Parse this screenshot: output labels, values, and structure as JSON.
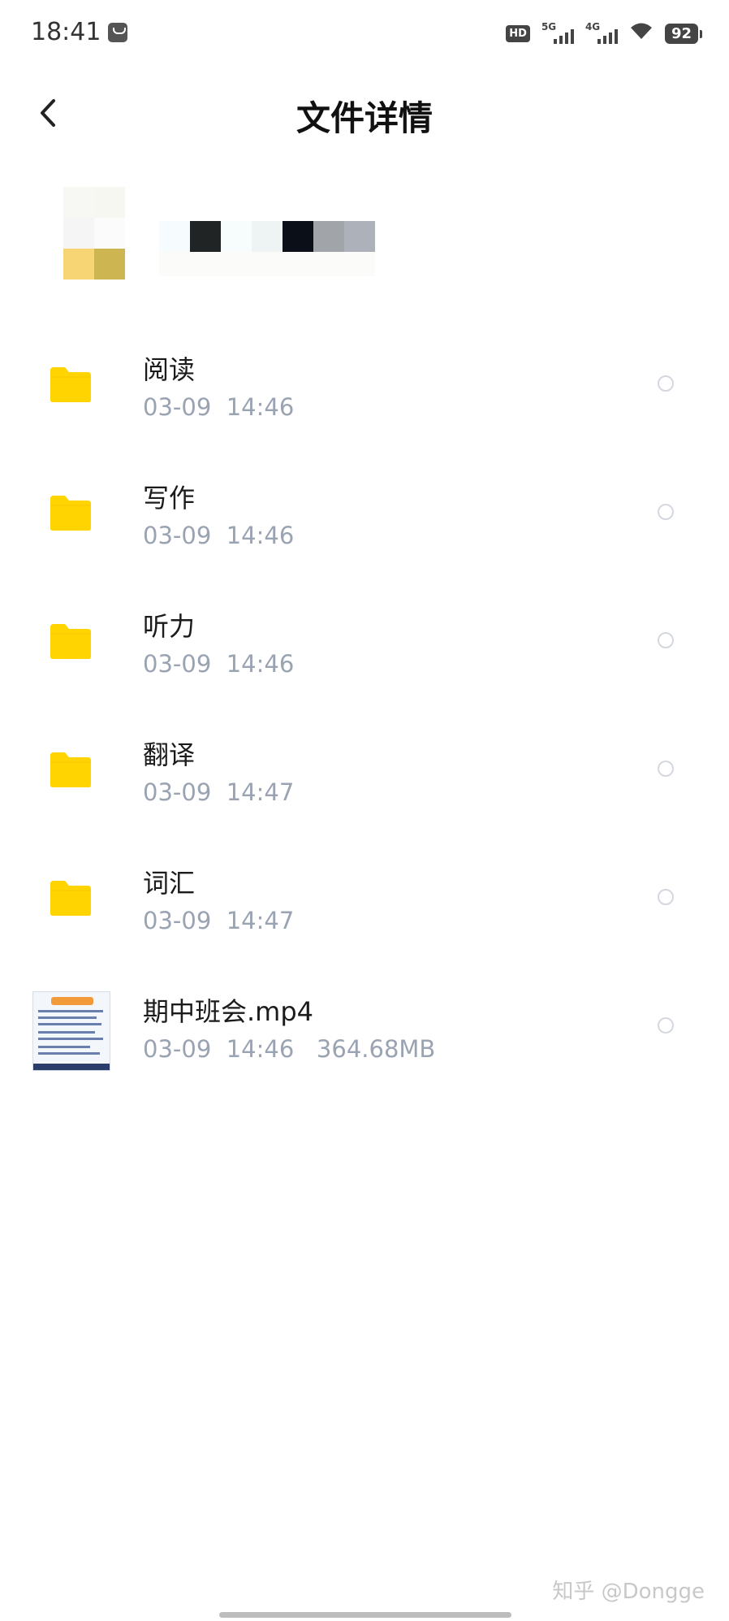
{
  "status_bar": {
    "time": "18:41",
    "hd_label": "HD",
    "network_1": "5G",
    "network_2": "4G",
    "battery": "92"
  },
  "header": {
    "title": "文件详情"
  },
  "files": [
    {
      "name": "阅读",
      "meta": "03-09  14:46",
      "icon": "folder-icon"
    },
    {
      "name": "写作",
      "meta": "03-09  14:46",
      "icon": "folder-icon"
    },
    {
      "name": "听力",
      "meta": "03-09  14:46",
      "icon": "folder-icon"
    },
    {
      "name": "翻译",
      "meta": "03-09  14:47",
      "icon": "folder-icon"
    },
    {
      "name": "词汇",
      "meta": "03-09  14:47",
      "icon": "folder-icon"
    },
    {
      "name": "期中班会.mp4",
      "meta": "03-09  14:46   364.68MB",
      "icon": "video-thumbnail"
    }
  ],
  "colors": {
    "folder": "#FFD400",
    "meta_text": "#9AA3B2"
  },
  "watermark": "知乎 @Dongge"
}
